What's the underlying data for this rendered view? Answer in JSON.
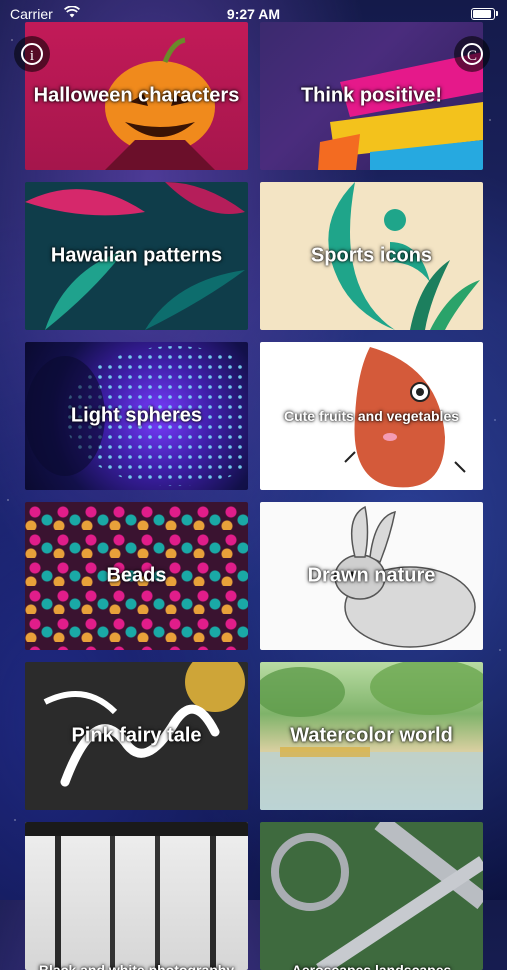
{
  "status_bar": {
    "carrier": "Carrier",
    "time": "9:27 AM",
    "battery_level": 1.0
  },
  "header": {
    "info_icon": "info-icon",
    "copyright_icon": "copyright-icon",
    "info_glyph": "i",
    "copyright_glyph": "C"
  },
  "collections": [
    {
      "title": "Halloween characters"
    },
    {
      "title": "Think positive!"
    },
    {
      "title": "Hawaiian patterns"
    },
    {
      "title": "Sports icons"
    },
    {
      "title": "Light spheres"
    },
    {
      "title": "Cute fruits and vegetables"
    },
    {
      "title": "Beads"
    },
    {
      "title": "Drawn nature"
    },
    {
      "title": "Pink fairy tale"
    },
    {
      "title": "Watercolor world"
    },
    {
      "title": "Black and white photography"
    },
    {
      "title": "Aeroscapes landscapes"
    }
  ],
  "colors": {
    "background": "#1d2566",
    "title_text": "#ffffff"
  }
}
